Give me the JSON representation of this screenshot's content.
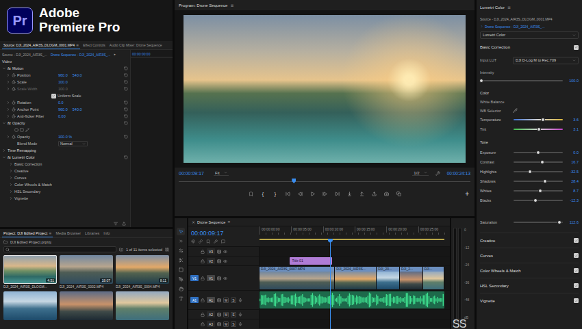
{
  "logo": {
    "mark": "Pr",
    "brand": "Adobe",
    "product": "Premiere Pro"
  },
  "effect_controls": {
    "tabs": [
      {
        "label": "Source: DJI_2024_AIR3S_DLOGM_0001.MP4",
        "selected": true
      },
      {
        "label": "Effect Controls",
        "selected": false
      },
      {
        "label": "Audio Clip Mixer: Drone Sequence",
        "selected": false
      }
    ],
    "menu": "≡",
    "source": "Source - DJI_2024_AIR3S_...",
    "sequence": "Drone Sequence - DJI_2024_AIR3S_...",
    "arrow": "▸",
    "timecode": "00:00:00:00",
    "group": "Video",
    "rows": [
      {
        "kind": "section",
        "badge": "fx",
        "label": "Motion",
        "expanded": true
      },
      {
        "kind": "param",
        "label": "Position",
        "values": [
          "960.0",
          "540.0"
        ],
        "disabled": false
      },
      {
        "kind": "param",
        "label": "Scale",
        "values": [
          "100.0"
        ],
        "disabled": false
      },
      {
        "kind": "param",
        "label": "Scale Width",
        "values": [
          "100.0"
        ],
        "disabled": true
      },
      {
        "kind": "checkbox",
        "label": "Uniform Scale",
        "checked": true
      },
      {
        "kind": "param",
        "label": "Rotation",
        "values": [
          "0.0"
        ],
        "disabled": false
      },
      {
        "kind": "param",
        "label": "Anchor Point",
        "values": [
          "960.0",
          "540.0"
        ],
        "disabled": false
      },
      {
        "kind": "param",
        "label": "Anti-flicker Filter",
        "values": [
          "0.00"
        ],
        "disabled": false
      },
      {
        "kind": "section",
        "badge": "fx",
        "label": "Opacity",
        "expanded": true
      },
      {
        "kind": "masks"
      },
      {
        "kind": "param",
        "label": "Opacity",
        "values": [
          "100.0 %"
        ],
        "disabled": false
      },
      {
        "kind": "select",
        "label": "Blend Mode",
        "value": "Normal"
      },
      {
        "kind": "group",
        "label": "Time Remapping",
        "expanded": false
      },
      {
        "kind": "section",
        "badge": "fx",
        "label": "Lumetri Color",
        "expanded": true
      },
      {
        "kind": "sub",
        "label": "Basic Correction",
        "expanded": false
      },
      {
        "kind": "sub",
        "label": "Creative",
        "expanded": false
      },
      {
        "kind": "sub",
        "label": "Curves",
        "expanded": false
      },
      {
        "kind": "sub",
        "label": "Color Wheels & Match",
        "expanded": false
      },
      {
        "kind": "sub",
        "label": "HSL Secondary",
        "expanded": false
      },
      {
        "kind": "sub",
        "label": "Vignette",
        "expanded": false
      }
    ]
  },
  "project": {
    "tabs": [
      {
        "label": "Project: DJI Edited Project",
        "selected": true
      },
      {
        "label": "Media Browser",
        "selected": false
      },
      {
        "label": "Libraries",
        "selected": false
      },
      {
        "label": "Info",
        "selected": false
      }
    ],
    "menu": "≡",
    "file": "DJI Edited Project.prproj",
    "count": "1 of 11 items selected",
    "items": [
      {
        "name": "DJI_2024_AIR3S_DLOGM...",
        "duration": "4:51",
        "selected": true
      },
      {
        "name": "DJI_2024_AIR3S_0002.MP4",
        "duration": "18:07",
        "selected": false
      },
      {
        "name": "DJI_2024_AIR3S_0004.MP4",
        "duration": "8:11",
        "selected": false
      },
      {
        "selected": false
      },
      {
        "selected": false
      },
      {
        "selected": false
      }
    ]
  },
  "program": {
    "title": "Program: Drone Sequence",
    "menu": "≡",
    "timecode": "00:00:09:17",
    "zoom": "Fit",
    "resolution": "1/2",
    "duration": "00:00:24:13",
    "level": 0.395,
    "mark_in": "{",
    "mark_out": "}",
    "add": "+"
  },
  "timeline": {
    "close": "×",
    "title": "Drone Sequence",
    "menu": "≡",
    "timecode": "00:00:09:17",
    "ruler": [
      "00:00:00:00",
      "00:00:05:00",
      "00:00:10:00",
      "00:00:15:00",
      "00:00:20:00",
      "00:00:25:00"
    ],
    "level": 0.37,
    "tools": [
      {
        "selected": true
      },
      {
        "selected": false
      },
      {
        "selected": false
      },
      {
        "selected": false
      },
      {
        "selected": false
      },
      {
        "selected": false
      },
      {
        "selected": false
      },
      {
        "selected": false
      }
    ],
    "tracks": [
      {
        "name": "V3",
        "kind": "video",
        "targeted": false,
        "expanded": false,
        "clip_kind": "none",
        "clips": []
      },
      {
        "name": "V2",
        "kind": "video",
        "targeted": false,
        "expanded": false,
        "clip_kind": "graphic",
        "clips": [
          "Title 01"
        ]
      },
      {
        "name": "V1",
        "kind": "video",
        "targeted": true,
        "expanded": true,
        "patch": "V1",
        "clip_kind": "footage",
        "clips": [
          "DJI_2024_AIR3S_0007.MP4",
          "DJI_2024_AIR3S...",
          "DJI_20...",
          "DJI_2...",
          "DJI..."
        ]
      },
      {
        "name": "A1",
        "kind": "audio",
        "targeted": true,
        "expanded": true,
        "patch": "A1",
        "mute": "M",
        "solo": "S",
        "audio_clip": true
      },
      {
        "name": "A2",
        "kind": "audio",
        "targeted": false,
        "expanded": false,
        "mute": "M",
        "solo": "S",
        "audio_clip": false
      },
      {
        "name": "A3",
        "kind": "audio",
        "targeted": false,
        "expanded": false,
        "mute": "M",
        "solo": "S",
        "audio_clip": false
      }
    ]
  },
  "meters": {
    "ticks": [
      "0",
      "-12",
      "-24",
      "-36",
      "-48",
      "dB"
    ],
    "solo": [
      "S",
      "S"
    ]
  },
  "lumetri": {
    "title": "Lumetri Color",
    "menu": "≡",
    "source": "Source - DJI_2024_AIR3S_DLOGM_0001.MP4",
    "sequence": "Drone Sequence - DJI_2024_AIR3S_...",
    "preset": "Lumetri Color",
    "basic": {
      "title": "Basic Correction",
      "checked": true
    },
    "lut": {
      "label": "Input LUT",
      "value": "DJI D-Log M to Rec.709"
    },
    "intensity": {
      "label": "Intensity",
      "level": 0.02,
      "reading": "100.0"
    },
    "color_label": "Color",
    "white_balance": "White Balance",
    "wb_selector": "WB Selector",
    "white_sliders": [
      {
        "label": "Temperature",
        "kind": "temperature",
        "level": 0.6,
        "reading": "3.6"
      },
      {
        "label": "Tint",
        "kind": "tint",
        "level": 0.52,
        "reading": "3.1"
      }
    ],
    "tone_label": "Tone",
    "tone_sliders": [
      {
        "label": "Exposure",
        "kind": "plain",
        "level": 0.5,
        "reading": "0.0"
      },
      {
        "label": "Contrast",
        "kind": "plain",
        "level": 0.58,
        "reading": "16.7"
      },
      {
        "label": "Highlights",
        "kind": "plain",
        "level": 0.34,
        "reading": "-32.5"
      },
      {
        "label": "Shadows",
        "kind": "plain",
        "level": 0.64,
        "reading": "28.4"
      },
      {
        "label": "Whites",
        "kind": "plain",
        "level": 0.54,
        "reading": "8.7"
      },
      {
        "label": "Blacks",
        "kind": "plain",
        "level": 0.44,
        "reading": "-12.3"
      }
    ],
    "saturation": {
      "label": "Saturation",
      "kind": "plain",
      "level": 0.93,
      "reading": "112.6"
    },
    "sections": [
      {
        "title": "Creative",
        "checked": true
      },
      {
        "title": "Curves",
        "checked": true
      },
      {
        "title": "Color Wheels & Match",
        "checked": true
      },
      {
        "title": "HSL Secondary",
        "checked": true
      },
      {
        "title": "Vignette",
        "checked": true
      }
    ]
  }
}
